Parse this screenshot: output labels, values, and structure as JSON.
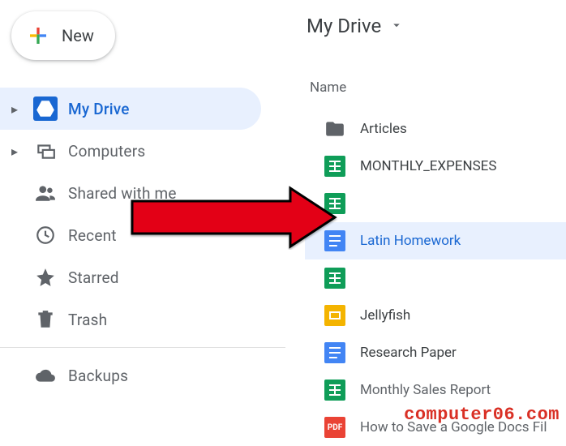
{
  "new_button": {
    "label": "New"
  },
  "sidebar": {
    "items": [
      {
        "id": "my-drive",
        "label": "My Drive",
        "expandable": true,
        "selected": true
      },
      {
        "id": "computers",
        "label": "Computers",
        "expandable": true
      },
      {
        "id": "shared",
        "label": "Shared with me"
      },
      {
        "id": "recent",
        "label": "Recent"
      },
      {
        "id": "starred",
        "label": "Starred"
      },
      {
        "id": "trash",
        "label": "Trash"
      }
    ],
    "backups": {
      "label": "Backups"
    }
  },
  "breadcrumb": {
    "label": "My Drive"
  },
  "columns": {
    "name": "Name"
  },
  "files": [
    {
      "type": "folder",
      "name": "Articles"
    },
    {
      "type": "sheet",
      "name": "MONTHLY_EXPENSES"
    },
    {
      "type": "sheet",
      "name": ""
    },
    {
      "type": "doc",
      "name": "Latin Homework",
      "selected": true
    },
    {
      "type": "sheet",
      "name": ""
    },
    {
      "type": "slide",
      "name": "Jellyfish"
    },
    {
      "type": "doc",
      "name": "Research Paper"
    },
    {
      "type": "sheet",
      "name": "Monthly Sales Report"
    },
    {
      "type": "pdf",
      "name": "How to Save a Google Docs Fil"
    }
  ],
  "watermark": "computer06.com"
}
